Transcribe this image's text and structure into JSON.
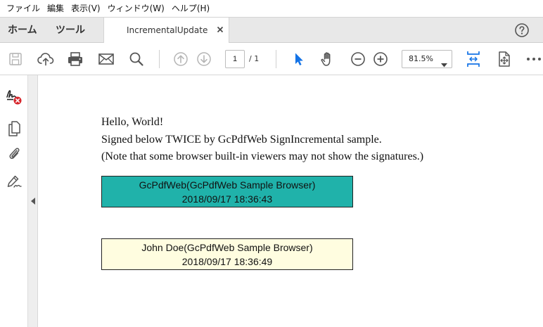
{
  "menu": [
    {
      "key": "file",
      "label": "ファイル"
    },
    {
      "key": "edit",
      "label": "編集"
    },
    {
      "key": "view",
      "label": "表示(V)"
    },
    {
      "key": "window",
      "label": "ウィンドウ(W)"
    },
    {
      "key": "help",
      "label": "ヘルプ(H)"
    }
  ],
  "tabs": {
    "home": "ホーム",
    "tools": "ツール",
    "document": "IncrementalUpdate"
  },
  "toolbar": {
    "page_current": "1",
    "page_total": "/ 1",
    "zoom": "81.5%"
  },
  "document": {
    "lines": [
      "Hello, World!",
      "Signed below TWICE by GcPdfWeb SignIncremental sample.",
      "(Note that some browser built-in viewers may not show the signatures.)"
    ],
    "signatures": [
      {
        "name": "GcPdfWeb(GcPdfWeb Sample Browser)",
        "date": "2018/09/17 18:36:43",
        "color": "#20b2aa"
      },
      {
        "name": "John Doe(GcPdfWeb Sample Browser)",
        "date": "2018/09/17 18:36:49",
        "color": "#fffde0"
      }
    ]
  },
  "colors": {
    "accent_blue": "#1473e6",
    "icon_gray": "#555555",
    "disabled_gray": "#b5b5b5"
  }
}
